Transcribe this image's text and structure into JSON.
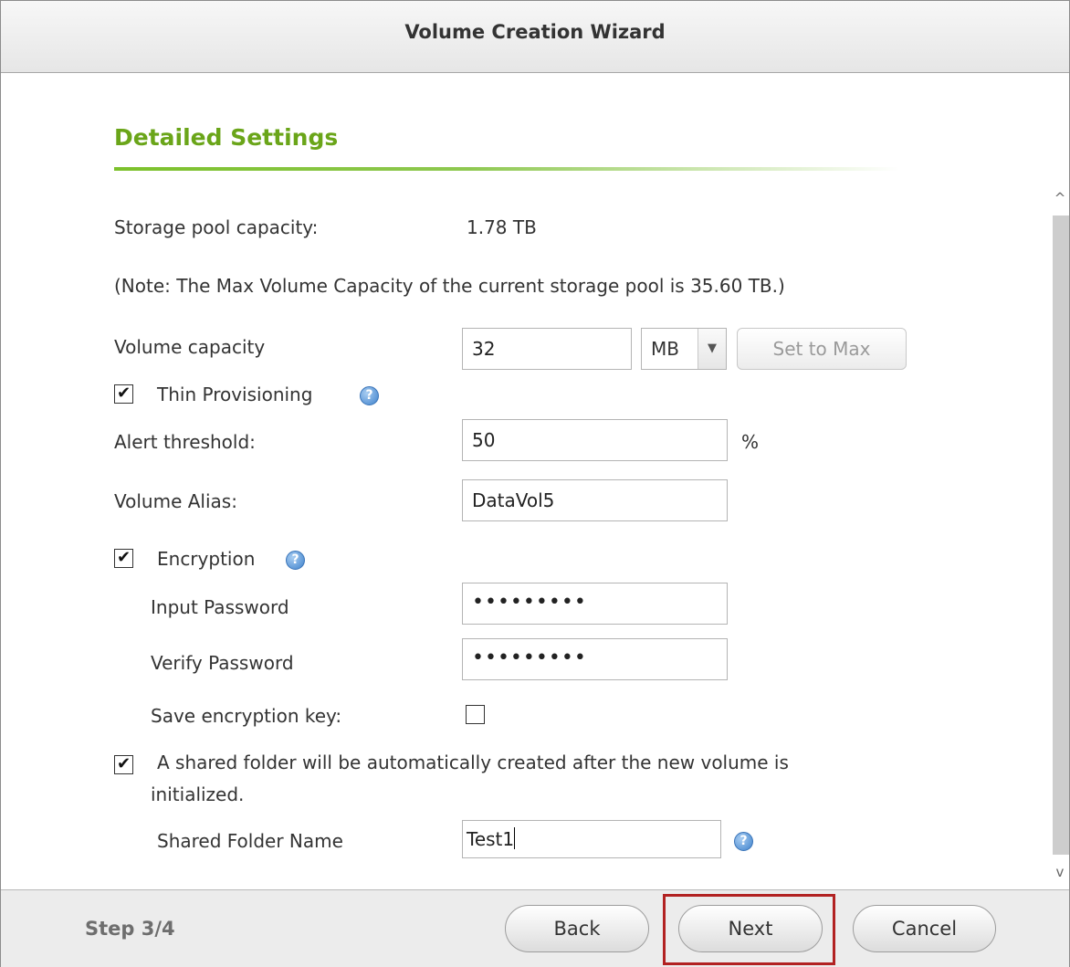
{
  "window": {
    "title": "Volume Creation Wizard"
  },
  "section": {
    "title": "Detailed Settings"
  },
  "form": {
    "storage_pool_label": "Storage pool capacity:",
    "storage_pool_value": "1.78 TB",
    "note": "(Note: The Max Volume Capacity of the current storage pool is 35.60 TB.)",
    "volume_capacity_label": "Volume capacity",
    "volume_capacity_value": "32",
    "unit_selected": "MB",
    "set_to_max_label": "Set to Max",
    "thin_provisioning_label": "Thin Provisioning",
    "thin_provisioning_checked": true,
    "alert_threshold_label": "Alert threshold:",
    "alert_threshold_value": "50",
    "alert_threshold_unit": "%",
    "volume_alias_label": "Volume Alias:",
    "volume_alias_value": "DataVol5",
    "encryption_label": "Encryption",
    "encryption_checked": true,
    "input_password_label": "Input Password",
    "input_password_value": "•••••••••",
    "verify_password_label": "Verify Password",
    "verify_password_value": "•••••••••",
    "save_key_label": "Save encryption key:",
    "save_key_checked": false,
    "shared_folder_line1": "A shared folder will be automatically created after the new volume is",
    "shared_folder_line2": "initialized.",
    "shared_folder_checked": true,
    "shared_folder_name_label": "Shared Folder Name",
    "shared_folder_name_value": "Test1"
  },
  "footer": {
    "step": "Step 3/4",
    "back_label": "Back",
    "next_label": "Next",
    "cancel_label": "Cancel"
  },
  "icons": {
    "check": "✔",
    "help": "?",
    "dropdown_arrow": "▼",
    "scroll_up": "^",
    "scroll_down": "v"
  },
  "colors": {
    "section_title": "#6aa519",
    "highlight": "#b22222",
    "help_icon": "#3f82cc"
  }
}
